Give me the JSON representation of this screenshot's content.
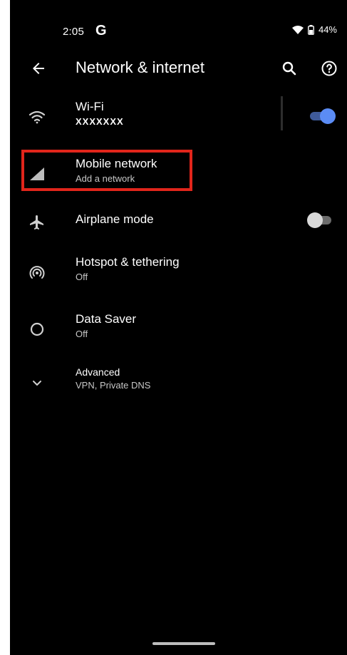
{
  "statusbar": {
    "time": "2:05",
    "g_label": "G",
    "battery": "44%"
  },
  "appbar": {
    "title": "Network & internet"
  },
  "items": [
    {
      "primary": "Wi-Fi",
      "secondary": "XXXXXXX"
    },
    {
      "primary": "Mobile network",
      "secondary": "Add a network"
    },
    {
      "primary": "Airplane mode",
      "secondary": ""
    },
    {
      "primary": "Hotspot & tethering",
      "secondary": "Off"
    },
    {
      "primary": "Data Saver",
      "secondary": "Off"
    },
    {
      "primary": "Advanced",
      "secondary": "VPN, Private DNS"
    }
  ],
  "toggles": {
    "wifi": "on",
    "airplane": "off"
  },
  "colors": {
    "background": "#000000",
    "accent": "#5b8cf5",
    "toggle_off": "#d9d9d9",
    "highlight": "#e1251b"
  },
  "icons": [
    "back-arrow-icon",
    "search-icon",
    "help-icon",
    "wifi-icon",
    "mobile-signal-icon",
    "airplane-icon",
    "hotspot-icon",
    "data-saver-icon",
    "chevron-down-icon",
    "battery-icon"
  ]
}
